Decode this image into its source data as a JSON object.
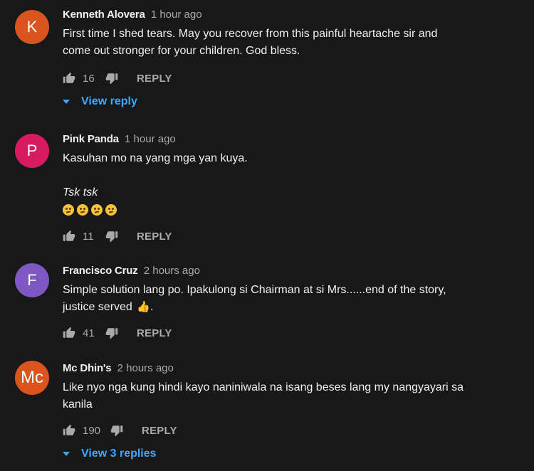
{
  "comments": [
    {
      "avatar_letter": "K",
      "avatar_color": "#d9541e",
      "author": "Kenneth Alovera",
      "time": "1 hour ago",
      "lines": [
        "First time I shed tears. May you recover from this painful heartache sir and",
        "come out stronger for your children. God bless."
      ],
      "likes": "16",
      "reply_label": "REPLY",
      "view_replies": "View reply"
    },
    {
      "avatar_letter": "P",
      "avatar_color": "#d81b60",
      "author": "Pink Panda",
      "time": "1 hour ago",
      "lines": [
        "Kasuhan mo na yang mga yan kuya.",
        "Tsk tsk"
      ],
      "emoji_count": 4,
      "likes": "11",
      "reply_label": "REPLY"
    },
    {
      "avatar_letter": "F",
      "avatar_color": "#7e57c2",
      "author": "Francisco Cruz",
      "time": "2 hours ago",
      "lines": [
        "Simple solution lang po. Ipakulong si Chairman at si Mrs......end of the story,",
        "justice served",
        "."
      ],
      "likes": "41",
      "reply_label": "REPLY"
    },
    {
      "avatar_letter": "Mc",
      "avatar_color": "#d9541e",
      "author": "Mc Dhin's",
      "time": "2 hours ago",
      "lines": [
        "Like nyo nga kung hindi kayo naniniwala na isang beses lang my nangyayari sa",
        "kanila"
      ],
      "likes": "190",
      "reply_label": "REPLY",
      "view_replies": "View 3 replies"
    }
  ],
  "icons": {
    "like": "thumbs-up-icon",
    "dislike": "thumbs-down-icon",
    "caret": "caret-down-icon",
    "emoji": "confused-face-emoji",
    "thumb_emoji": "thumbs-up-emoji"
  }
}
